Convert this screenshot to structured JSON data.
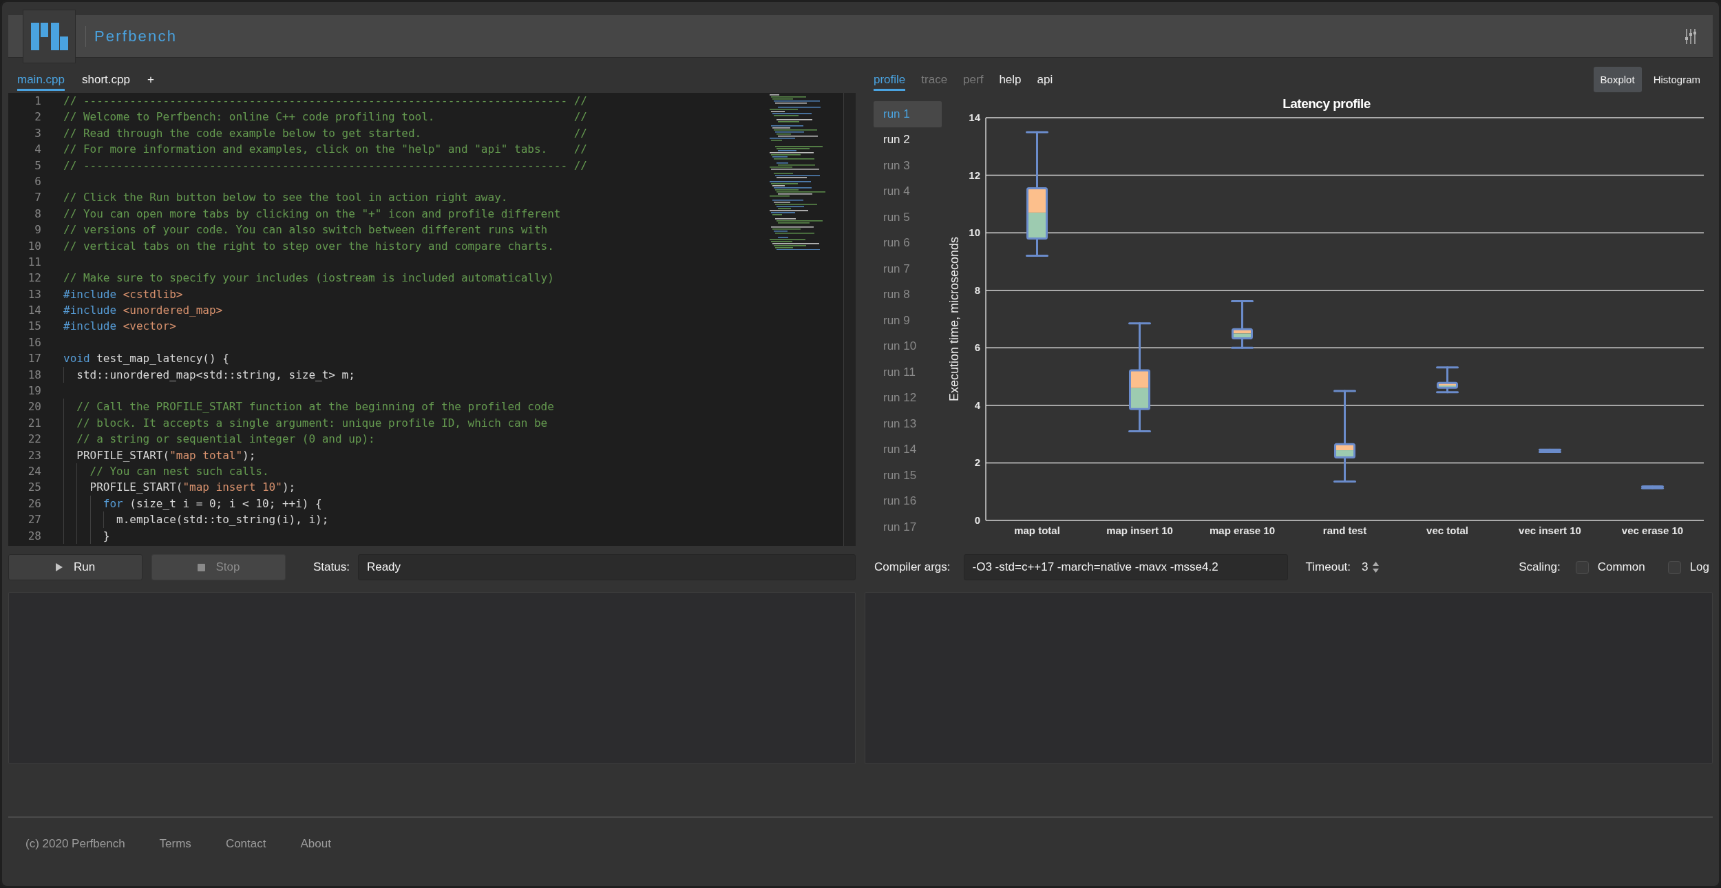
{
  "header": {
    "title": "Perfbench"
  },
  "editor": {
    "tabs": [
      {
        "label": "main.cpp",
        "selected": true
      },
      {
        "label": "short.cpp",
        "selected": false
      }
    ],
    "add_tab": "+",
    "lines": [
      {
        "number": "1",
        "tokens": [
          {
            "kind": "comment",
            "text": "// ------------------------------------------------------------------------- //"
          }
        ]
      },
      {
        "number": "2",
        "tokens": [
          {
            "kind": "comment",
            "text": "// Welcome to Perfbench: online C++ code profiling tool.                     //"
          }
        ]
      },
      {
        "number": "3",
        "tokens": [
          {
            "kind": "comment",
            "text": "// Read through the code example below to get started.                       //"
          }
        ]
      },
      {
        "number": "4",
        "tokens": [
          {
            "kind": "comment",
            "text": "// For more information and examples, click on the \"help\" and \"api\" tabs.    //"
          }
        ]
      },
      {
        "number": "5",
        "tokens": [
          {
            "kind": "comment",
            "text": "// ------------------------------------------------------------------------- //"
          }
        ]
      },
      {
        "number": "6"
      },
      {
        "number": "7",
        "tokens": [
          {
            "kind": "comment",
            "text": "// Click the Run button below to see the tool in action right away."
          }
        ]
      },
      {
        "number": "8",
        "tokens": [
          {
            "kind": "comment",
            "text": "// You can open more tabs by clicking on the \"+\" icon and profile different"
          }
        ]
      },
      {
        "number": "9",
        "tokens": [
          {
            "kind": "comment",
            "text": "// versions of your code. You can also switch between different runs with"
          }
        ]
      },
      {
        "number": "10",
        "tokens": [
          {
            "kind": "comment",
            "text": "// vertical tabs on the right to step over the history and compare charts."
          }
        ]
      },
      {
        "number": "11"
      },
      {
        "number": "12",
        "tokens": [
          {
            "kind": "comment",
            "text": "// Make sure to specify your includes (iostream is included automatically)"
          }
        ]
      },
      {
        "number": "13",
        "tokens": [
          {
            "kind": "keyword",
            "text": "#include "
          },
          {
            "kind": "string",
            "text": "<cstdlib>"
          }
        ]
      },
      {
        "number": "14",
        "tokens": [
          {
            "kind": "keyword",
            "text": "#include "
          },
          {
            "kind": "string",
            "text": "<unordered_map>"
          }
        ]
      },
      {
        "number": "15",
        "tokens": [
          {
            "kind": "keyword",
            "text": "#include "
          },
          {
            "kind": "string",
            "text": "<vector>"
          }
        ]
      },
      {
        "number": "16"
      },
      {
        "number": "17",
        "tokens": [
          {
            "kind": "keyword",
            "text": "void"
          },
          {
            "kind": "plain",
            "text": " test_map_latency() {"
          }
        ]
      },
      {
        "number": "18",
        "tokens": [
          {
            "kind": "plain",
            "text": "  std::unordered_map<std::string, size_t> m;"
          }
        ]
      },
      {
        "number": "19"
      },
      {
        "number": "20",
        "tokens": [
          {
            "kind": "comment",
            "text": "  // Call the PROFILE_START function at the beginning of the profiled code"
          }
        ]
      },
      {
        "number": "21",
        "tokens": [
          {
            "kind": "comment",
            "text": "  // block. It accepts a single argument: unique profile ID, which can be"
          }
        ]
      },
      {
        "number": "22",
        "tokens": [
          {
            "kind": "comment",
            "text": "  // a string or sequential integer (0 and up):"
          }
        ]
      },
      {
        "number": "23",
        "tokens": [
          {
            "kind": "plain",
            "text": "  PROFILE_START("
          },
          {
            "kind": "string",
            "text": "\"map total\""
          },
          {
            "kind": "plain",
            "text": ");"
          }
        ]
      },
      {
        "number": "24",
        "tokens": [
          {
            "kind": "comment",
            "text": "    // You can nest such calls."
          }
        ]
      },
      {
        "number": "25",
        "tokens": [
          {
            "kind": "plain",
            "text": "    PROFILE_START("
          },
          {
            "kind": "string",
            "text": "\"map insert 10\""
          },
          {
            "kind": "plain",
            "text": ");"
          }
        ]
      },
      {
        "number": "26",
        "tokens": [
          {
            "kind": "keyword",
            "text": "      for"
          },
          {
            "kind": "plain",
            "text": " (size_t i = 0; i < 10; ++i) {"
          }
        ]
      },
      {
        "number": "27",
        "tokens": [
          {
            "kind": "plain",
            "text": "        m.emplace(std::to_string(i), i);"
          }
        ]
      },
      {
        "number": "28",
        "tokens": [
          {
            "kind": "plain",
            "text": "      }"
          }
        ]
      }
    ]
  },
  "run_controls": {
    "buttons": [
      {
        "kind": "run",
        "label": "Run",
        "disabled": false
      },
      {
        "kind": "stop",
        "label": "Stop",
        "disabled": true
      }
    ],
    "status_label": "Status:",
    "status": "Ready"
  },
  "profile_panel": {
    "view_tabs": [
      {
        "label": "profile",
        "selected": true,
        "disabled": false
      },
      {
        "label": "trace",
        "selected": false,
        "disabled": true
      },
      {
        "label": "perf",
        "selected": false,
        "disabled": true
      },
      {
        "label": "help",
        "selected": false,
        "disabled": false
      },
      {
        "label": "api",
        "selected": false,
        "disabled": false
      }
    ],
    "chart_modes": [
      {
        "label": "Boxplot",
        "selected": true
      },
      {
        "label": "Histogram",
        "selected": false
      }
    ],
    "runs": [
      {
        "label": "run 1",
        "selected": true,
        "disabled": false
      },
      {
        "label": "run 2",
        "selected": false,
        "disabled": false
      },
      {
        "label": "run 3",
        "selected": false,
        "disabled": true
      },
      {
        "label": "run 4",
        "selected": false,
        "disabled": true
      },
      {
        "label": "run 5",
        "selected": false,
        "disabled": true
      },
      {
        "label": "run 6",
        "selected": false,
        "disabled": true
      },
      {
        "label": "run 7",
        "selected": false,
        "disabled": true
      },
      {
        "label": "run 8",
        "selected": false,
        "disabled": true
      },
      {
        "label": "run 9",
        "selected": false,
        "disabled": true
      },
      {
        "label": "run 10",
        "selected": false,
        "disabled": true
      },
      {
        "label": "run 11",
        "selected": false,
        "disabled": true
      },
      {
        "label": "run 12",
        "selected": false,
        "disabled": true
      },
      {
        "label": "run 13",
        "selected": false,
        "disabled": true
      },
      {
        "label": "run 14",
        "selected": false,
        "disabled": true
      },
      {
        "label": "run 15",
        "selected": false,
        "disabled": true
      },
      {
        "label": "run 16",
        "selected": false,
        "disabled": true
      },
      {
        "label": "run 17",
        "selected": false,
        "disabled": true
      }
    ],
    "chart_data": [
      {
        "type": "box",
        "title": "Latency profile",
        "ylabel": "Execution time, microseconds",
        "categories": [
          "map total",
          "map insert 10",
          "map erase 10",
          "rand test",
          "vec total",
          "vec insert 10",
          "vec erase 10"
        ],
        "boxes": [
          {
            "low": 9.2,
            "q1": 9.8,
            "median": 10.7,
            "q3": 11.55,
            "high": 13.5
          },
          {
            "low": 3.1,
            "q1": 3.87,
            "median": 4.6,
            "q3": 5.22,
            "high": 6.85
          },
          {
            "low": 6.0,
            "q1": 6.33,
            "median": 6.5,
            "q3": 6.65,
            "high": 7.62
          },
          {
            "low": 1.35,
            "q1": 2.19,
            "median": 2.44,
            "q3": 2.65,
            "high": 4.5
          },
          {
            "low": 4.46,
            "q1": 4.61,
            "median": 4.69,
            "q3": 4.78,
            "high": 5.32
          },
          {
            "low": 2.38,
            "q1": 2.39,
            "median": 2.42,
            "q3": 2.45,
            "high": 2.46
          },
          {
            "low": 1.12,
            "q1": 1.13,
            "median": 1.15,
            "q3": 1.17,
            "high": 1.18
          }
        ],
        "ylim": [
          0,
          14
        ],
        "yticks": [
          0,
          2,
          4,
          6,
          8,
          10,
          12,
          14
        ],
        "grid": true
      }
    ]
  },
  "options": {
    "compiler_args_label": "Compiler args:",
    "compiler_args": "-O3 -std=c++17 -march=native -mavx -msse4.2",
    "timeout_label": "Timeout:",
    "timeout": "3",
    "scaling_label": "Scaling:",
    "scaling": [
      {
        "label": "Common",
        "checked": false
      },
      {
        "label": "Log",
        "checked": false
      }
    ]
  },
  "footer": {
    "copyright": "(c) 2020 Perfbench",
    "links": [
      "Terms",
      "Contact",
      "About"
    ]
  }
}
